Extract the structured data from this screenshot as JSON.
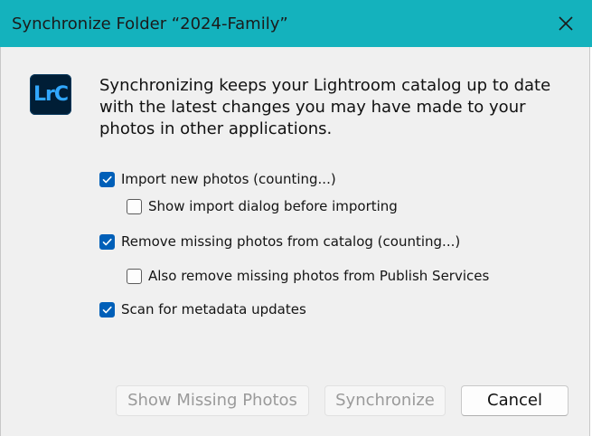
{
  "dialog": {
    "title": "Synchronize Folder “2024-Family”",
    "close_icon": "close-icon"
  },
  "app_icon": {
    "label": "LrC",
    "background": "#001e36",
    "foreground": "#31a8ff"
  },
  "message": {
    "line1": "Synchronizing keeps your Lightroom catalog up to date",
    "line2": "with the latest changes you may have made to your",
    "line3": "photos in other applications."
  },
  "options": {
    "import_new": {
      "label": "Import new photos (counting...)",
      "checked": true
    },
    "show_import_dialog": {
      "label": "Show import dialog before importing",
      "checked": false
    },
    "remove_missing": {
      "label": "Remove missing photos from catalog (counting...)",
      "checked": true
    },
    "remove_publish": {
      "label": "Also remove missing photos from Publish Services",
      "checked": false
    },
    "scan_metadata": {
      "label": "Scan for metadata updates",
      "checked": true
    }
  },
  "buttons": {
    "show_missing": "Show Missing Photos",
    "synchronize": "Synchronize",
    "cancel": "Cancel"
  },
  "colors": {
    "titlebar": "#14b2bd",
    "accent": "#005fb8",
    "client_background": "#f0f0f0"
  }
}
